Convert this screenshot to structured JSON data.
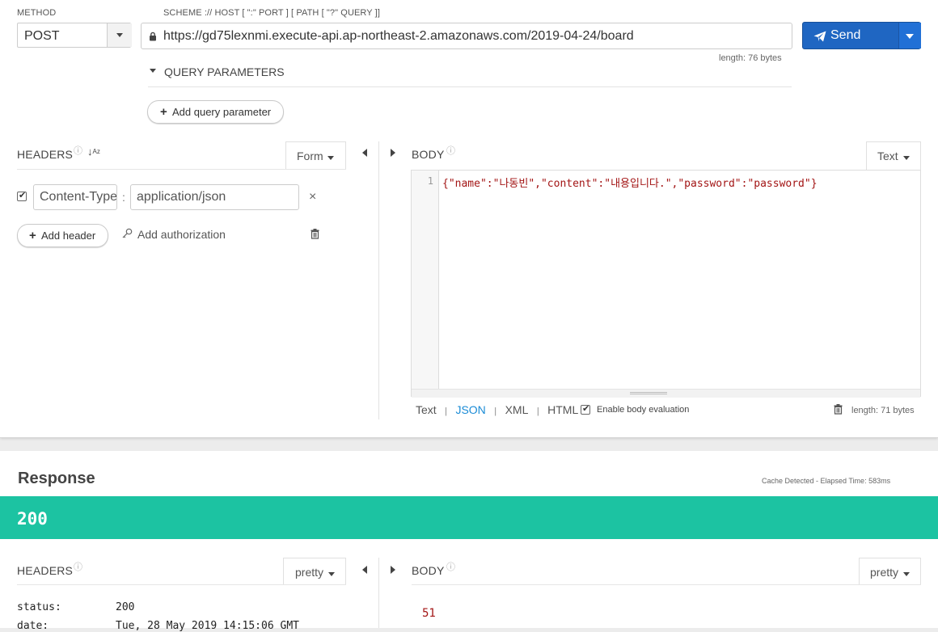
{
  "request": {
    "method_label": "METHOD",
    "method_value": "POST",
    "url_label": "SCHEME :// HOST [ \":\" PORT ] [ PATH [ \"?\" QUERY ]]",
    "url_value": "https://gd75lexnmi.execute-api.ap-northeast-2.amazonaws.com/2019-04-24/board",
    "url_length": "length: 76 bytes",
    "send_label": "Send",
    "query_params_label": "QUERY PARAMETERS",
    "add_query_param_label": "Add query parameter",
    "headers": {
      "title": "HEADERS",
      "mode": "Form",
      "items": [
        {
          "enabled": true,
          "name": "Content-Type",
          "value": "application/json"
        }
      ],
      "add_header_label": "Add header",
      "add_authorization_label": "Add authorization"
    },
    "body": {
      "title": "BODY",
      "mode": "Text",
      "line_number": "1",
      "content": "{\"name\":\"나동빈\",\"content\":\"내용입니다.\",\"password\":\"password\"}",
      "formats": [
        "Text",
        "JSON",
        "XML",
        "HTML"
      ],
      "active_format": "JSON",
      "enable_evaluation_label": "Enable body evaluation",
      "length": "length: 71 bytes"
    }
  },
  "response": {
    "title": "Response",
    "meta": "Cache Detected - Elapsed Time: 583ms",
    "status_code": "200",
    "status_color": "#1cc3a2",
    "headers": {
      "title": "HEADERS",
      "mode": "pretty",
      "rows": [
        {
          "key": "status:",
          "value": "200"
        },
        {
          "key": "date:",
          "value": "Tue, 28 May 2019 14:15:06 GMT"
        }
      ]
    },
    "body": {
      "title": "BODY",
      "mode": "pretty",
      "content": "51"
    }
  },
  "colors": {
    "send_button": "#1f66c2",
    "active_link": "#1a8bd6",
    "json_string": "#a31515"
  }
}
